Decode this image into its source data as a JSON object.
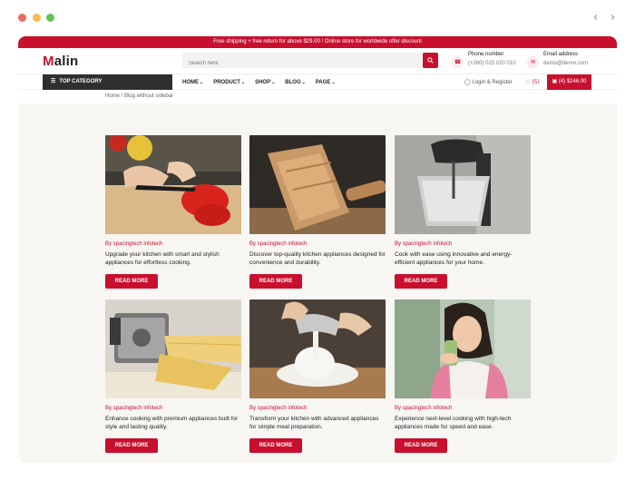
{
  "browser": {
    "back_icon": "chevron-left-icon",
    "forward_icon": "chevron-right-icon"
  },
  "promo_text": "Free shipping + free return for above $29.00   /   Online store for worldwide offer discount",
  "logo": {
    "first_letter": "M",
    "rest": "alin"
  },
  "search": {
    "placeholder": "Search here",
    "icon": "search-icon"
  },
  "contact": {
    "phone_label": "Phone number",
    "phone_value": "(+260) 025 020 010",
    "email_label": "Email address",
    "email_value": "demo@demo.com"
  },
  "nav": {
    "top_category": "TOP CATEGORY",
    "menu": [
      {
        "label": "HOME"
      },
      {
        "label": "PRODUCT"
      },
      {
        "label": "SHOP"
      },
      {
        "label": "BLOG"
      },
      {
        "label": "PAGE"
      }
    ],
    "login": "Login & Register",
    "wishlist_count": "(5)",
    "cart": "(4) $246.00"
  },
  "breadcrumb": "Home / Blog without sidebar",
  "posts": [
    {
      "author": "By spacingtech infotech",
      "excerpt": "Upgrade your kitchen with smart and stylish appliances for effortless cooking.",
      "button": "READ MORE"
    },
    {
      "author": "By spacingtech infotech",
      "excerpt": "Discover top-quality kitchen appliances designed for convenience and durability.",
      "button": "READ MORE"
    },
    {
      "author": "By spacingtech infotech",
      "excerpt": "Cook with ease using innovative and energy-efficient appliances for your home.",
      "button": "READ MORE"
    },
    {
      "author": "By spacingtech infotech",
      "excerpt": "Enhance cooking with premium appliances built for style and lasting quality.",
      "button": "READ MORE"
    },
    {
      "author": "By spacingtech infotech",
      "excerpt": "Transform your kitchen with advanced appliances for simple meal preparation.",
      "button": "READ MORE"
    },
    {
      "author": "By spacingtech infotech",
      "excerpt": "Experience next-level cooking with high-tech appliances made for speed and ease.",
      "button": "READ MORE"
    }
  ],
  "colors": {
    "accent": "#c8102e",
    "dark": "#2f2f2f",
    "content_bg": "#f7f6f3"
  }
}
